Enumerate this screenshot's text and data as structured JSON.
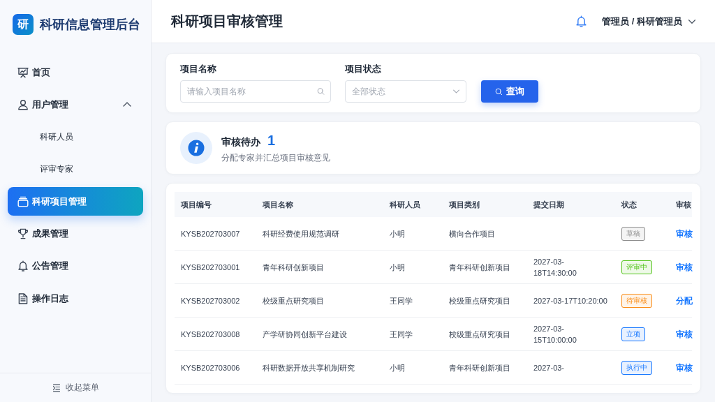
{
  "sidebar": {
    "logo_mark": "研",
    "title": "科研信息管理后台",
    "nav": [
      {
        "label": "首页",
        "selected": false
      },
      {
        "label": "用户管理",
        "selected": false,
        "expanded": true,
        "children": [
          {
            "label": "科研人员",
            "selected": false
          },
          {
            "label": "评审专家",
            "selected": false
          }
        ]
      },
      {
        "label": "科研项目管理",
        "selected": true
      },
      {
        "label": "成果管理",
        "selected": false
      },
      {
        "label": "公告管理",
        "selected": false
      },
      {
        "label": "操作日志",
        "selected": false
      }
    ],
    "collapse": "收起菜单"
  },
  "header": {
    "title": "科研项目审核管理",
    "user": "管理员 / 科研管理员"
  },
  "filters": {
    "fields": [
      {
        "kind": "search",
        "label": "项目名称",
        "placeholder": "请输入项目名称"
      },
      {
        "kind": "select",
        "label": "项目状态",
        "placeholder": "全部状态"
      }
    ],
    "button": "查询"
  },
  "summary": {
    "title": "审核待办",
    "count": "1",
    "description": "分配专家并汇总项目审核意见"
  },
  "table": {
    "columns": [
      "项目编号",
      "项目名称",
      "科研人员",
      "项目类别",
      "提交日期",
      "状态",
      "审核"
    ],
    "rows": [
      {
        "id": "KYSB202703007",
        "name": "科研经费使用规范调研",
        "researcher": "小明",
        "category": "横向合作项目",
        "status": "草稿",
        "color": "#8c8c8c",
        "action": "审核"
      },
      {
        "id": "KYSB202703001",
        "name": "青年科研创新项目",
        "researcher": "小明",
        "category": "青年科研创新项目",
        "date": "2027-03-\n18T14:30:00",
        "status": "评审中",
        "color": "#52c41a",
        "action": "审核"
      },
      {
        "id": "KYSB202703002",
        "name": "校级重点研究项目",
        "researcher": "王同学",
        "category": "校级重点研究项目",
        "date": "2027-03-17T10:20:00",
        "status": "待审核",
        "color": "#fa8c16",
        "action": "分配"
      },
      {
        "id": "KYSB202703008",
        "name": "产学研协同创新平台建设",
        "researcher": "王同学",
        "category": "校级重点研究项目",
        "date": "2027-03-\n15T10:00:00",
        "status": "立项",
        "color": "#1677ff",
        "action": "审核"
      },
      {
        "id": "KYSB202703006",
        "name": "科研数据开放共享机制研究",
        "researcher": "小明",
        "category": "青年科研创新项目",
        "date": "2027-03-",
        "status": "执行中",
        "color": "#1677ff",
        "action": "审核"
      }
    ]
  }
}
